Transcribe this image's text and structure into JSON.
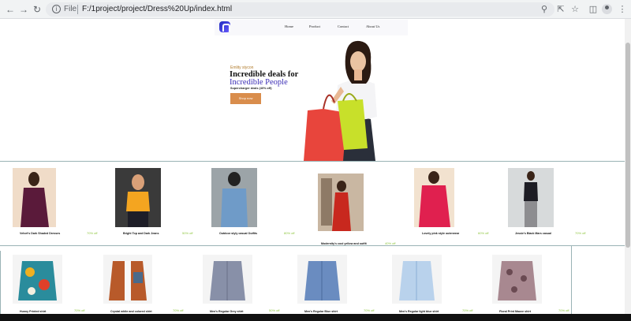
{
  "browser": {
    "file_label": "File",
    "url": "F:/1project/project/Dress%20Up/index.html"
  },
  "nav": {
    "links": [
      "Home",
      "Product",
      "Contact",
      "About Us"
    ]
  },
  "hero": {
    "subtitle": "Emlity stycon",
    "title_line1": "Incredible deals for",
    "title_line2": "Incredible People",
    "small_text": "Supercharger deals (40% off)",
    "button_label": "Shop now"
  },
  "row1": [
    {
      "name": "Velvet's Dark Shaded Dresses",
      "discount": "70% off"
    },
    {
      "name": "Bright Top and Dark Jeans",
      "discount": "50% off"
    },
    {
      "name": "Outdoor styly casual Outfits",
      "discount": "80% off"
    },
    {
      "name": "Modernity's cool yellow and outfit",
      "discount": "40% off"
    },
    {
      "name": "Lovely pink style outerwear",
      "discount": "60% off"
    },
    {
      "name": "Jessie's Black Mars casual",
      "discount": "70% off"
    }
  ],
  "row2": [
    {
      "name": "Hunny Printed shirt",
      "discount": "70% off"
    },
    {
      "name": "Crystal white and colored shirt",
      "discount": "70% off"
    },
    {
      "name": "Men's Regular Grey shirt",
      "discount": "50% off"
    },
    {
      "name": "Men's Regular Blue shirt",
      "discount": "70% off"
    },
    {
      "name": "Men's Regular light blue shirt",
      "discount": "70% off"
    },
    {
      "name": "Floral Print Mauve shirt",
      "discount": "70% off"
    }
  ],
  "colors": {
    "accent": "#3b2db5",
    "button": "#d98d4c",
    "discount": "#8ec63f"
  }
}
